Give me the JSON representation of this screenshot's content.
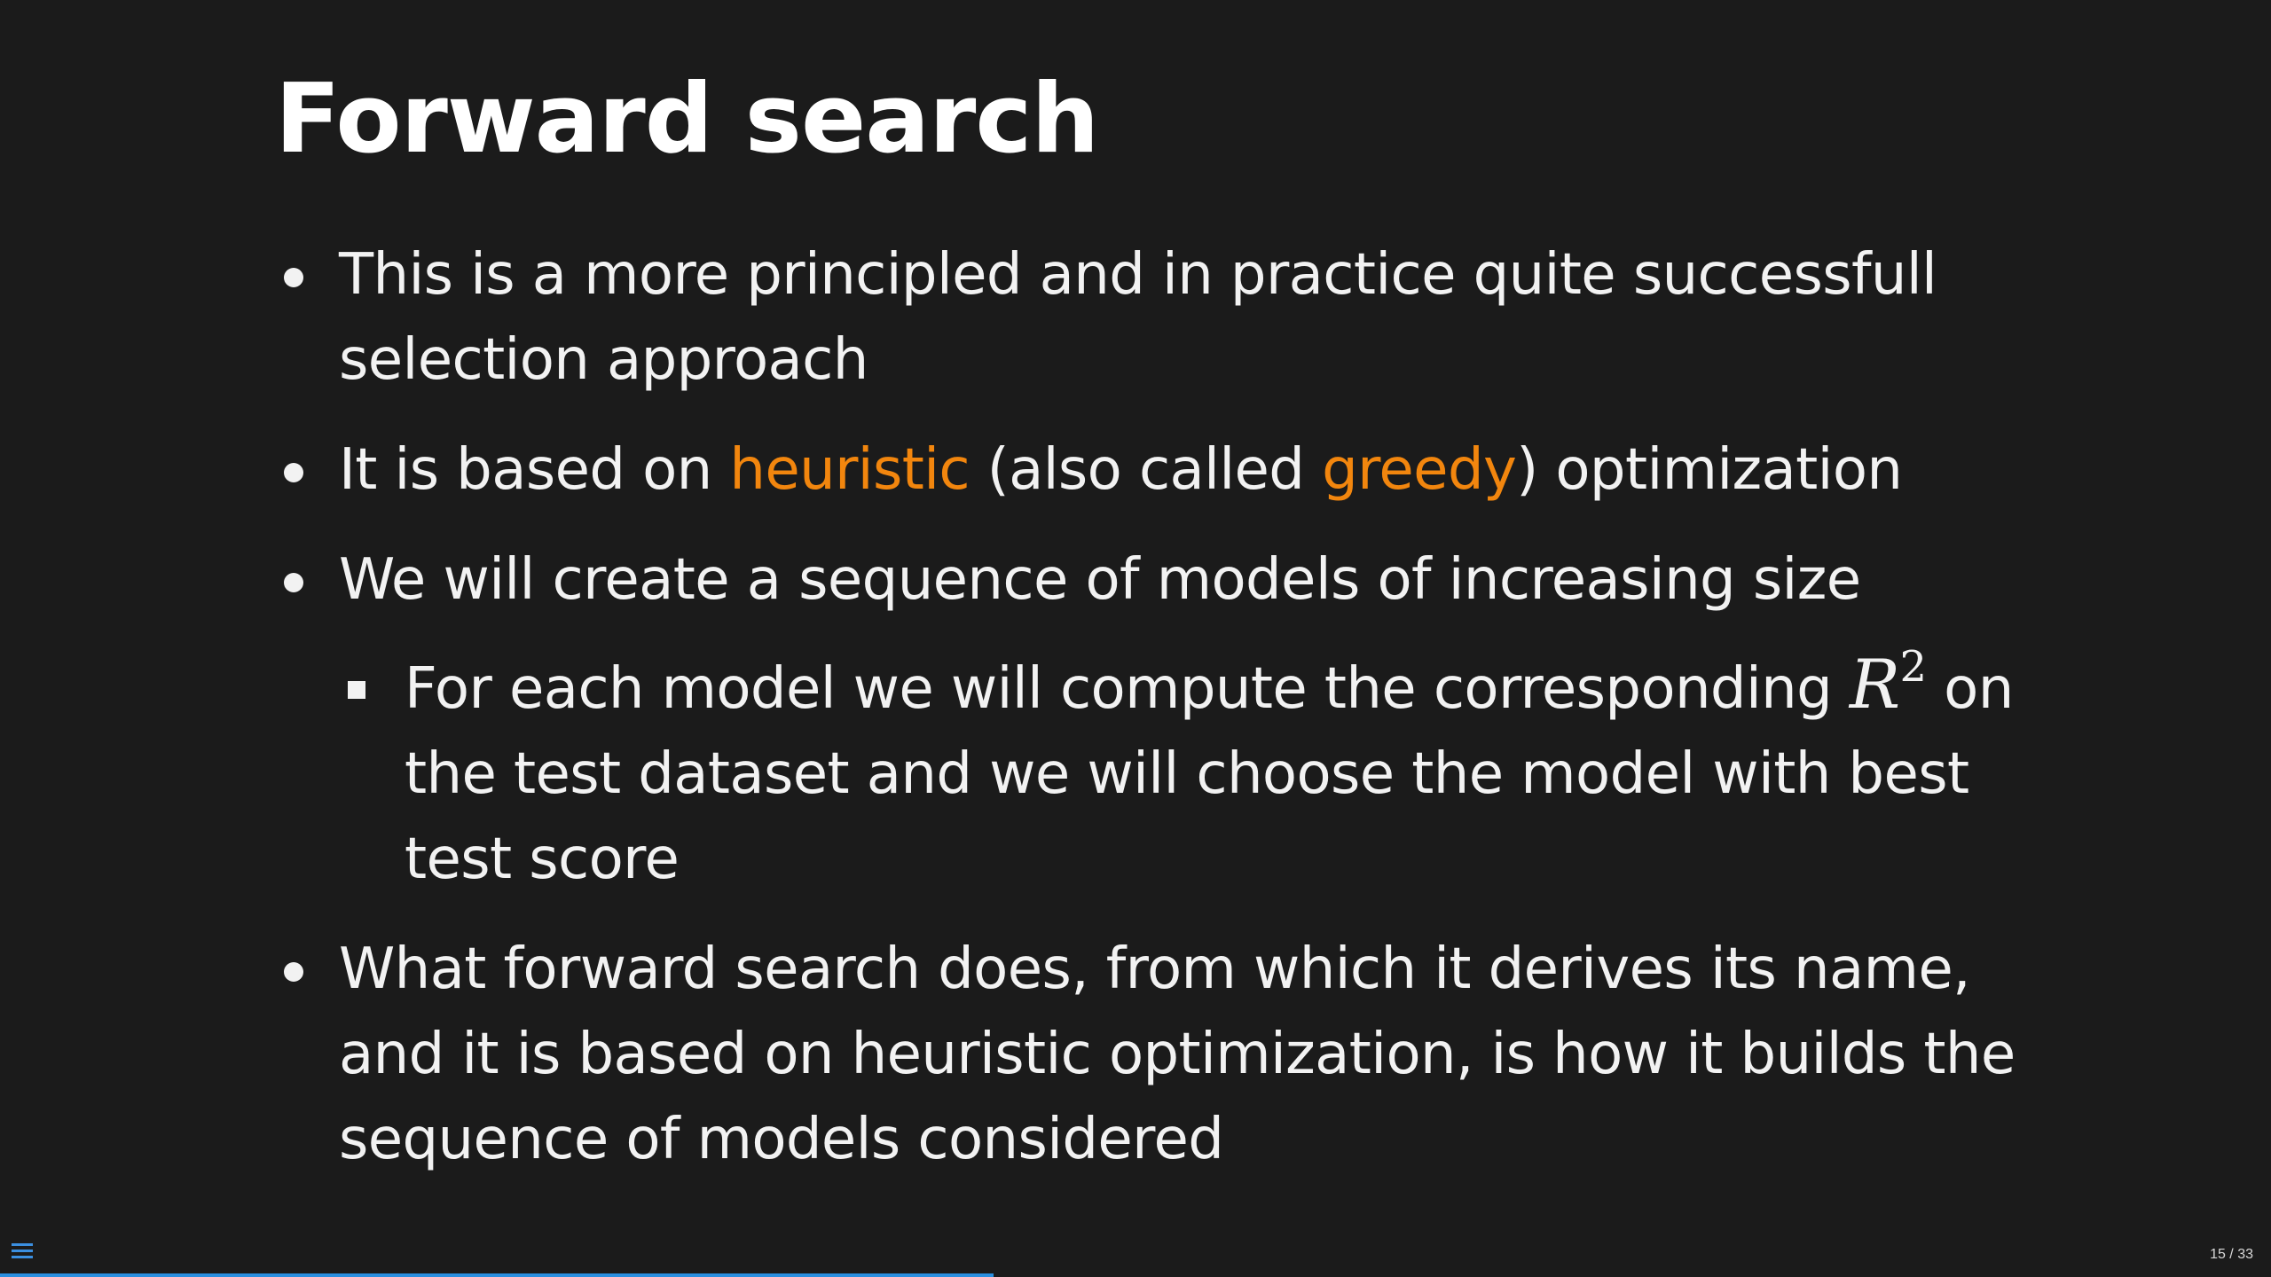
{
  "slide": {
    "title": "Forward search",
    "bullets": [
      {
        "text": "This is a more principled and in practice quite successfull selection approach"
      },
      {
        "parts": [
          "It is based on ",
          "heuristic",
          " (also called ",
          "greedy",
          ") optimization"
        ]
      },
      {
        "text": "We will create a sequence of models of increasing size",
        "sub": {
          "before": "For each model we will compute the corresponding ",
          "math_base": "R",
          "math_exp": "2",
          "after": " on the test dataset and we will choose the model with best test score"
        }
      },
      {
        "text": "What forward search does, from which it derives its name, and it is based on heuristic optimization, is how it builds the sequence of models considered"
      }
    ],
    "accent_color": "#f2860e",
    "background_color": "#1b1b1b"
  },
  "navigation": {
    "menu_icon": "hamburger-menu-icon",
    "slide_number": "15 / 33",
    "current_slide": 15,
    "total_slides": 33,
    "progress_fraction": 0.4375,
    "progress_color": "#2a8fe0"
  }
}
